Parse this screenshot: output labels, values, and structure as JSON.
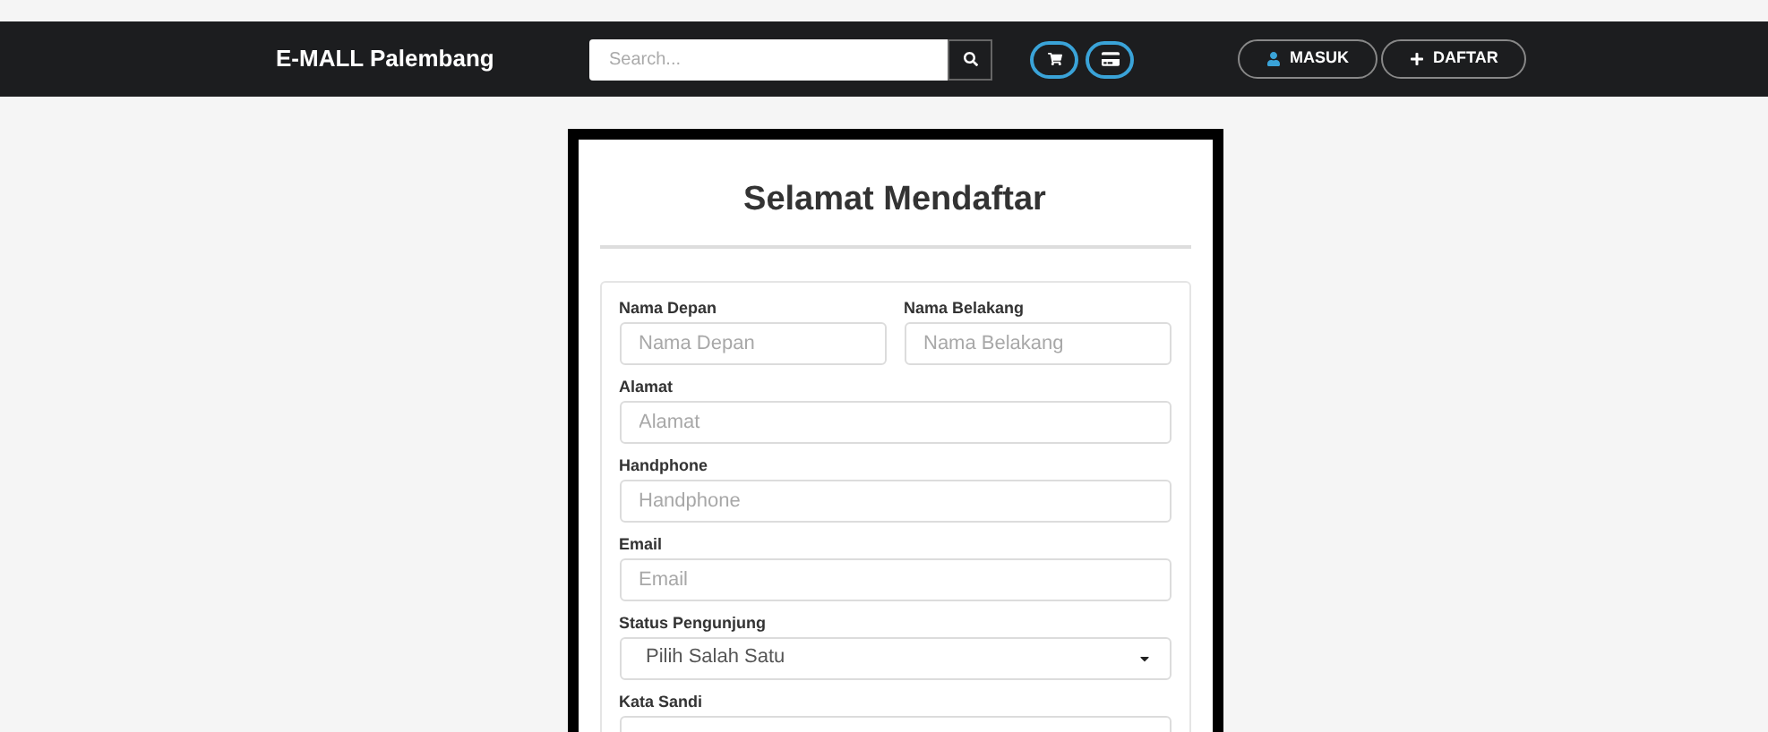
{
  "navbar": {
    "brand": "E-MALL Palembang",
    "search": {
      "placeholder": "Search..."
    },
    "buttons": [
      {
        "label": "MASUK",
        "kind": "login"
      },
      {
        "label": "DAFTAR",
        "kind": "register"
      }
    ]
  },
  "form": {
    "title": "Selamat Mendaftar",
    "rows": [
      [
        {
          "kind": "text",
          "label": "Nama Depan",
          "placeholder": "Nama Depan"
        },
        {
          "kind": "text",
          "label": "Nama Belakang",
          "placeholder": "Nama Belakang"
        }
      ],
      [
        {
          "kind": "text",
          "label": "Alamat",
          "placeholder": "Alamat"
        }
      ],
      [
        {
          "kind": "text",
          "label": "Handphone",
          "placeholder": "Handphone"
        }
      ],
      [
        {
          "kind": "text",
          "label": "Email",
          "placeholder": "Email"
        }
      ],
      [
        {
          "kind": "select",
          "label": "Status Pengunjung",
          "value": "Pilih Salah Satu"
        }
      ],
      [
        {
          "kind": "password",
          "label": "Kata Sandi"
        }
      ]
    ]
  }
}
